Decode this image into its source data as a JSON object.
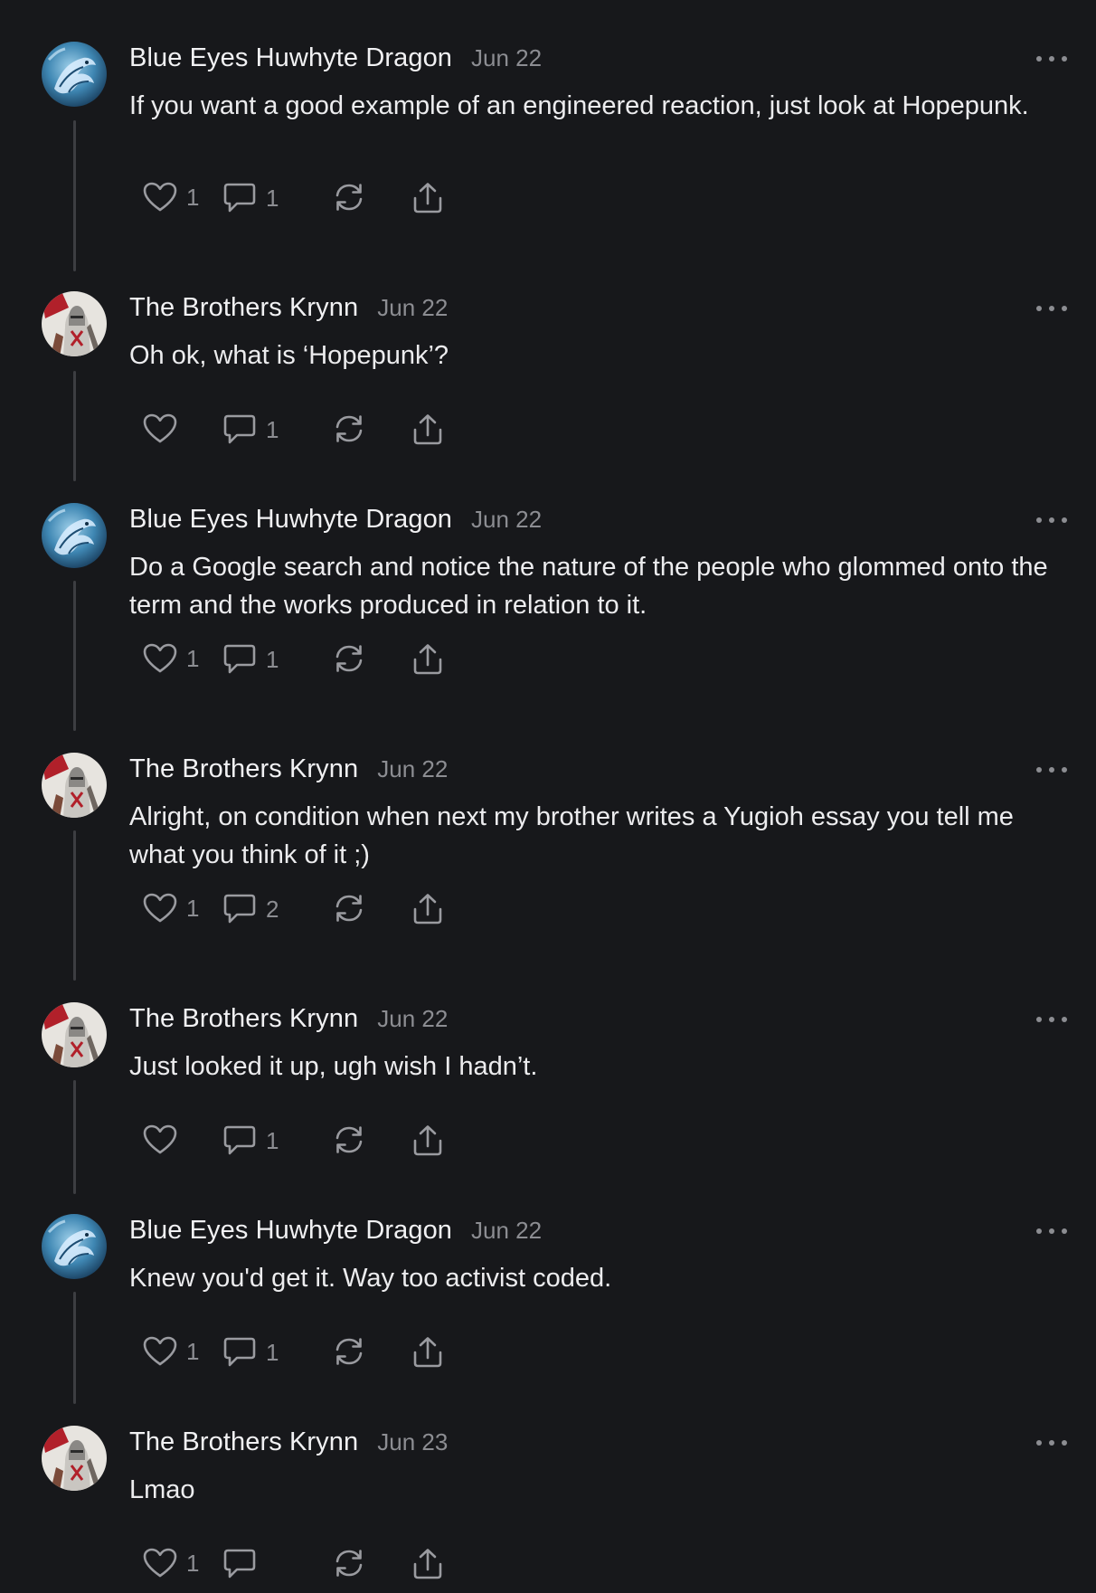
{
  "thread": {
    "posts": [
      {
        "author": "Blue Eyes Huwhyte Dragon",
        "avatar_icon": "dragon-avatar-icon",
        "date": "Jun 22",
        "body": "If you want a good example of an engineered reaction, just look at Hopepunk.",
        "likes": "1",
        "comments": "1"
      },
      {
        "author": "The Brothers Krynn",
        "avatar_icon": "knight-avatar-icon",
        "date": "Jun 22",
        "body": "Oh ok, what is ‘Hopepunk’?",
        "likes": "",
        "comments": "1"
      },
      {
        "author": "Blue Eyes Huwhyte Dragon",
        "avatar_icon": "dragon-avatar-icon",
        "date": "Jun 22",
        "body": "Do a Google search and notice the nature of the people who glommed onto the term and the works produced in relation to it.",
        "likes": "1",
        "comments": "1"
      },
      {
        "author": "The Brothers Krynn",
        "avatar_icon": "knight-avatar-icon",
        "date": "Jun 22",
        "body": "Alright, on condition when next my brother writes a Yugioh essay you tell me what you think of it ;)",
        "likes": "1",
        "comments": "2"
      },
      {
        "author": "The Brothers Krynn",
        "avatar_icon": "knight-avatar-icon",
        "date": "Jun 22",
        "body": "Just looked it up, ugh wish I hadn’t.",
        "likes": "",
        "comments": "1"
      },
      {
        "author": "Blue Eyes Huwhyte Dragon",
        "avatar_icon": "dragon-avatar-icon",
        "date": "Jun 22",
        "body": "Knew you'd get it. Way too activist coded.",
        "likes": "1",
        "comments": "1"
      },
      {
        "author": "The Brothers Krynn",
        "avatar_icon": "knight-avatar-icon",
        "date": "Jun 23",
        "body": "Lmao",
        "likes": "1",
        "comments": ""
      }
    ]
  },
  "icons": {
    "like": "heart-icon",
    "comment": "speech-bubble-icon",
    "restack": "refresh-arrows-icon",
    "share": "share-upload-icon",
    "more": "more-dots-icon"
  },
  "colors": {
    "background": "#17181b",
    "text": "#ececee",
    "muted": "#8c8d92",
    "thread_line": "#3d3e42"
  }
}
